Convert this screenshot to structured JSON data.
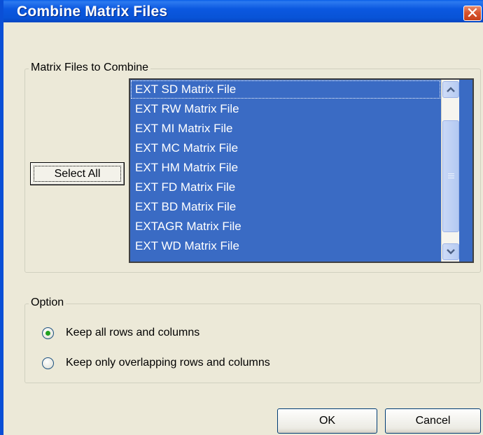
{
  "window": {
    "title": "Combine Matrix Files",
    "close_glyph": "✕"
  },
  "matrix_group": {
    "legend": "Matrix Files to Combine",
    "select_all_label": "Select All",
    "items": [
      "EXT SD Matrix File",
      "EXT RW Matrix File",
      "EXT MI Matrix File",
      "EXT MC Matrix File",
      "EXT HM Matrix File",
      "EXT FD Matrix File",
      "EXT BD Matrix File",
      "EXTAGR Matrix File",
      "EXT WD Matrix File"
    ]
  },
  "option_group": {
    "legend": "Option",
    "options": [
      {
        "label": "Keep all rows and columns",
        "checked": true
      },
      {
        "label": "Keep only overlapping rows and columns",
        "checked": false
      }
    ]
  },
  "buttons": {
    "ok": "OK",
    "cancel": "Cancel"
  },
  "colors": {
    "title_bar": "#0853d6",
    "selection": "#3a6bc4",
    "dialog_bg": "#ece9d8"
  },
  "icons": {
    "close": "close-icon",
    "scroll_up": "chevron-up-icon",
    "scroll_down": "chevron-down-icon"
  }
}
